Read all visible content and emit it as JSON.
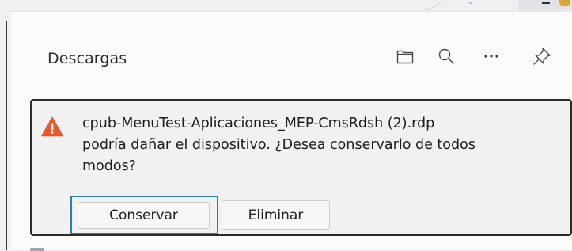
{
  "panel": {
    "title": "Descargas"
  },
  "toolbar": {
    "icons": [
      "folder-icon",
      "search-icon",
      "more-icon",
      "pin-icon"
    ]
  },
  "download": {
    "message_lines": [
      "cpub-MenuTest-Aplicaciones_MEP-CmsRdsh (2).rdp",
      "podría dañar el dispositivo. ¿Desea conservarlo de todos",
      "modos?"
    ],
    "keep_label": "Conservar",
    "delete_label": "Eliminar",
    "warning_icon": "warning-icon"
  },
  "colors": {
    "warning": "#e8562a",
    "focus_ring": "#2a7fb0"
  }
}
